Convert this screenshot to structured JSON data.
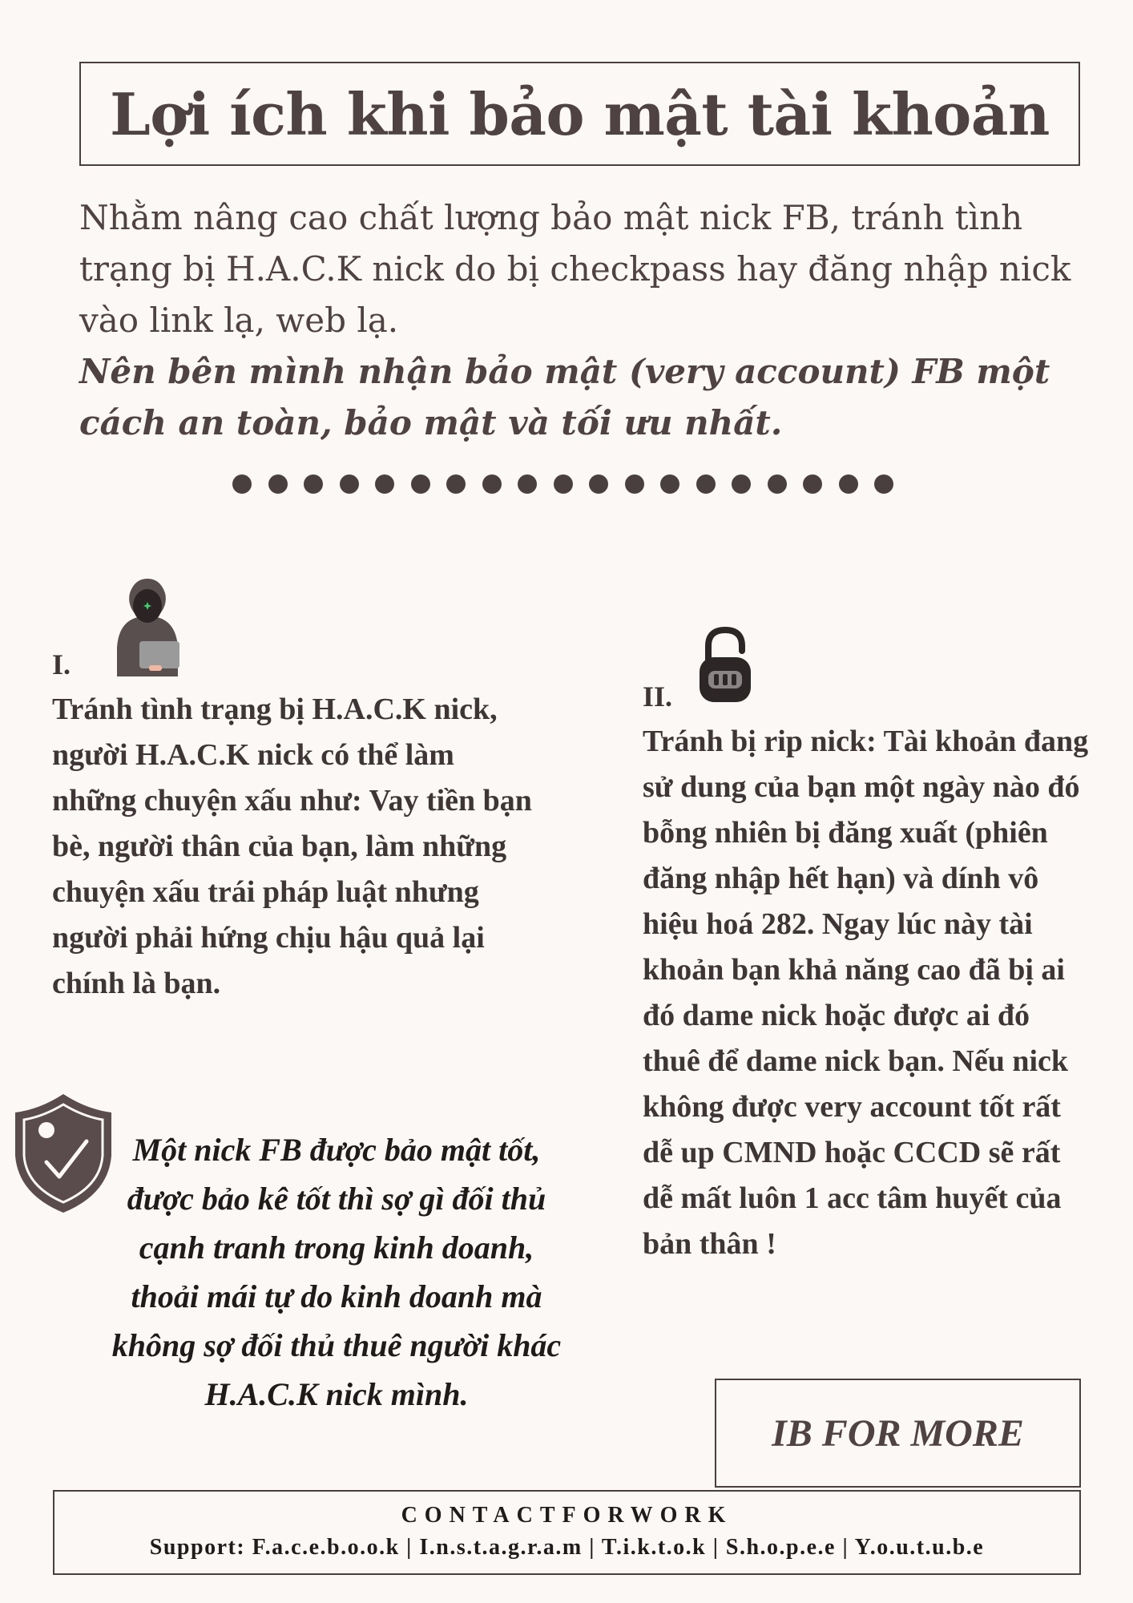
{
  "title": "Lợi ích khi bảo mật tài khoản",
  "intro": {
    "normal": "Nhằm nâng cao chất lượng bảo mật nick FB,  tránh tình trạng bị H.A.C.K nick do bị checkpass hay đăng nhập nick vào link lạ,  web lạ.",
    "emphasis": "Nên bên mình nhận bảo mật (very account) FB một cách an toàn, bảo mật và tối ưu nhất."
  },
  "section1": {
    "number": "I.",
    "icon": "hacker-icon",
    "text": "Tránh tình trạng bị H.A.C.K nick, người H.A.C.K nick có thể làm những chuyện xấu như: Vay tiền bạn bè,  người thân của bạn, làm những chuyện xấu trái pháp luật nhưng người phải hứng chịu hậu quả lại chính là bạn."
  },
  "section2": {
    "number": "II.",
    "icon": "padlock-icon",
    "text": "Tránh bị rip nick: Tài khoản đang sử dung của bạn một ngày nào đó bỗng nhiên bị đăng xuất (phiên đăng nhập hết hạn) và dính vô hiệu hoá 282. Ngay lúc này tài khoản bạn khả năng cao đã bị ai đó dame nick hoặc được ai đó thuê để dame nick bạn. Nếu nick không được very account tốt rất dễ up CMND hoặc CCCD sẽ rất dễ mất luôn 1 acc tâm huyết của bản thân !"
  },
  "quote": {
    "icon": "shield-check-icon",
    "text": "Một nick FB được bảo mật tốt, được bảo kê tốt thì sợ gì đối thủ cạnh tranh trong kinh doanh, thoải mái tự do kinh doanh mà không sợ đối thủ thuê người khác H.A.C.K nick mình."
  },
  "cta": "IB FOR MORE",
  "contact": {
    "title": "CONTACTFORWORK",
    "line": "Support: F.a.c.e.b.o.o.k | I.n.s.t.a.g.r.a.m | T.i.k.t.o.k | S.h.o.p.e.e | Y.o.u.t.u.b.e"
  },
  "colors": {
    "background": "#fcf8f5",
    "text": "#4a3f3f",
    "dark": "#1f1b1b"
  }
}
